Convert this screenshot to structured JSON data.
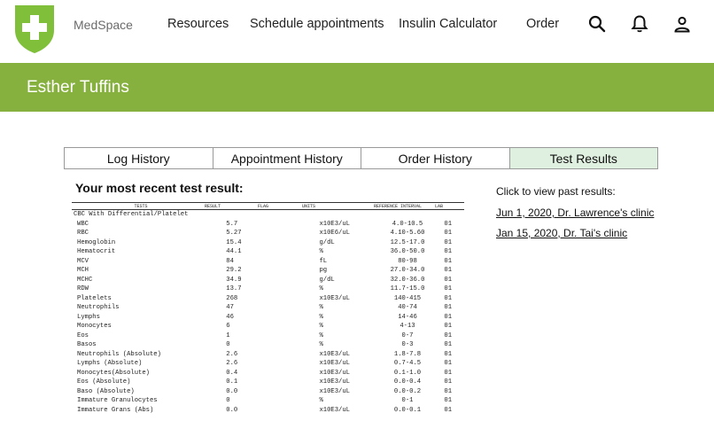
{
  "header": {
    "brand": "MedSpace",
    "nav": [
      "Resources",
      "Schedule appointments",
      "Insulin Calculator",
      "Order"
    ],
    "icons": [
      "search-icon",
      "bell-icon",
      "user-icon"
    ],
    "accent_color": "#86b13e"
  },
  "patient": {
    "name": "Esther Tuffins"
  },
  "tabs": [
    {
      "label": "Log History",
      "active": false
    },
    {
      "label": "Appointment History",
      "active": false
    },
    {
      "label": "Order History",
      "active": false
    },
    {
      "label": "Test Results",
      "active": true
    }
  ],
  "result_heading": "Your most recent test result:",
  "report": {
    "columns": [
      "TESTS",
      "RESULT",
      "FLAG",
      "UNITS",
      "REFERENCE INTERVAL",
      "LAB"
    ],
    "group": "CBC With Differential/Platelet",
    "rows": [
      [
        "WBC",
        "5.7",
        "",
        "x10E3/uL",
        "4.0-10.5",
        "01"
      ],
      [
        "RBC",
        "5.27",
        "",
        "x10E6/uL",
        "4.10-5.60",
        "01"
      ],
      [
        "Hemoglobin",
        "15.4",
        "",
        "g/dL",
        "12.5-17.0",
        "01"
      ],
      [
        "Hematocrit",
        "44.1",
        "",
        "%",
        "36.0-50.0",
        "01"
      ],
      [
        "MCV",
        "84",
        "",
        "fL",
        "80-98",
        "01"
      ],
      [
        "MCH",
        "29.2",
        "",
        "pg",
        "27.0-34.0",
        "01"
      ],
      [
        "MCHC",
        "34.9",
        "",
        "g/dL",
        "32.0-36.0",
        "01"
      ],
      [
        "RDW",
        "13.7",
        "",
        "%",
        "11.7-15.0",
        "01"
      ],
      [
        "Platelets",
        "268",
        "",
        "x10E3/uL",
        "140-415",
        "01"
      ],
      [
        "Neutrophils",
        "47",
        "",
        "%",
        "40-74",
        "01"
      ],
      [
        "Lymphs",
        "46",
        "",
        "%",
        "14-46",
        "01"
      ],
      [
        "Monocytes",
        "6",
        "",
        "%",
        "4-13",
        "01"
      ],
      [
        "Eos",
        "1",
        "",
        "%",
        "0-7",
        "01"
      ],
      [
        "Basos",
        "0",
        "",
        "%",
        "0-3",
        "01"
      ],
      [
        "Neutrophils (Absolute)",
        "2.6",
        "",
        "x10E3/uL",
        "1.8-7.8",
        "01"
      ],
      [
        "Lymphs (Absolute)",
        "2.6",
        "",
        "x10E3/uL",
        "0.7-4.5",
        "01"
      ],
      [
        "Monocytes(Absolute)",
        "0.4",
        "",
        "x10E3/uL",
        "0.1-1.0",
        "01"
      ],
      [
        "Eos (Absolute)",
        "0.1",
        "",
        "x10E3/uL",
        "0.0-0.4",
        "01"
      ],
      [
        "Baso (Absolute)",
        "0.0",
        "",
        "x10E3/uL",
        "0.0-0.2",
        "01"
      ],
      [
        "Immature Granulocytes",
        "0",
        "",
        "%",
        "0-1",
        "01"
      ],
      [
        "Immature Grans (Abs)",
        "0.0",
        "",
        "x10E3/uL",
        "0.0-0.1",
        "01"
      ]
    ]
  },
  "past_results": {
    "label": "Click to view past results:",
    "links": [
      "Jun 1, 2020, Dr. Lawrence's clinic",
      "Jan 15, 2020, Dr. Tai's clinic"
    ]
  }
}
